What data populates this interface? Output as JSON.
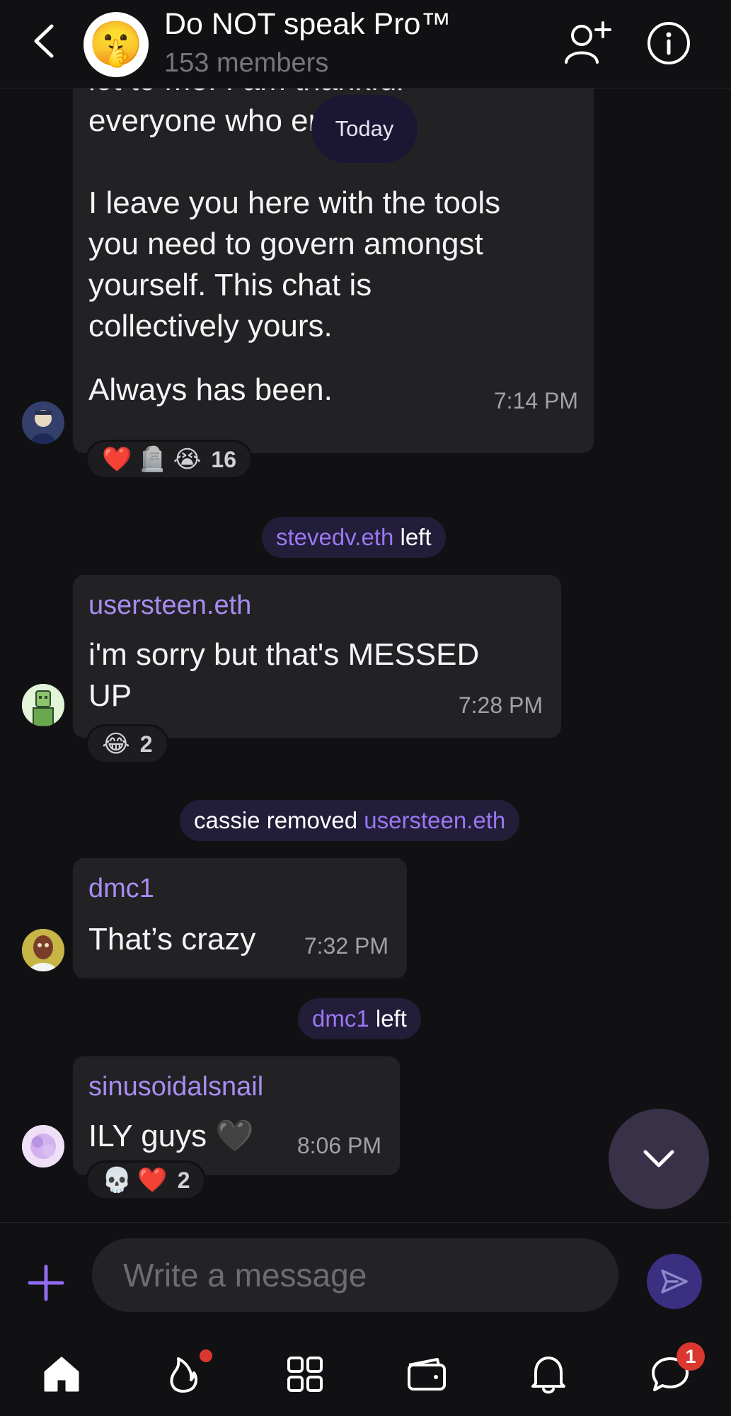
{
  "header": {
    "title": "Do NOT speak Pro™",
    "subtitle": "153 members",
    "avatar_emoji": "🤫"
  },
  "date_divider": "Today",
  "messages": [
    {
      "text_top_clipped": "lot to me. I am thankful",
      "text_line": "everyone who entered.",
      "text_body": "I leave you here with the tools\nyou need to govern amongst\nyourself. This chat is\ncollectively yours.",
      "text_last": "Always has been.",
      "time": "7:14 PM",
      "reactions": [
        "❤️",
        "🪦",
        "😭"
      ],
      "reaction_count": "16"
    },
    {
      "sender": "usersteen.eth",
      "text": "i'm sorry but that's MESSED\nUP",
      "time": "7:28 PM",
      "reactions": [
        "😂"
      ],
      "reaction_count": "2"
    },
    {
      "sender": "dmc1",
      "text": "That’s crazy",
      "time": "7:32 PM"
    },
    {
      "sender": "sinusoidalsnail",
      "text": "ILY guys 🖤",
      "time": "8:06 PM",
      "reactions": [
        "💀",
        "❤️"
      ],
      "reaction_count": "2"
    }
  ],
  "system_events": [
    {
      "user": "stevedv.eth",
      "action": " left"
    },
    {
      "actor": "cassie removed ",
      "user": "usersteen.eth"
    },
    {
      "user": "dmc1",
      "action": " left"
    }
  ],
  "composer": {
    "placeholder": "Write a message"
  },
  "nav": {
    "items": [
      "home-icon",
      "flame-icon",
      "apps-grid-icon",
      "wallet-icon",
      "bell-icon",
      "chat-icon"
    ],
    "chat_badge": "1"
  },
  "colors": {
    "background": "#111113",
    "bubble": "#222224",
    "accent": "#a98cf2",
    "system_pill": "#221d38",
    "badge": "#d9372f"
  }
}
